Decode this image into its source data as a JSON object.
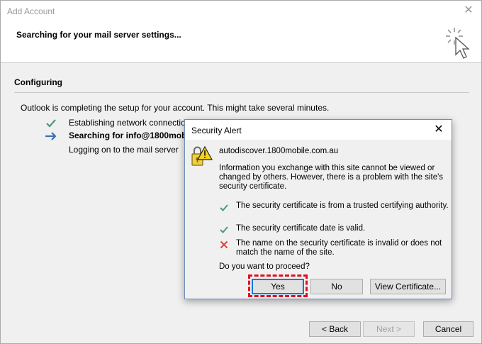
{
  "window": {
    "title": "Add Account",
    "close_glyph": "✕"
  },
  "header": {
    "heading": "Searching for your mail server settings...",
    "busy_icon": "busy-cursor-icon"
  },
  "section": {
    "title": "Configuring",
    "intro": "Outlook is completing the setup for your account. This might take several minutes."
  },
  "steps": [
    {
      "icon": "check-icon",
      "label": "Establishing network connection"
    },
    {
      "icon": "arrow-right-icon",
      "label": "Searching for info@1800mobile.com.au server settings"
    },
    {
      "icon": "none",
      "label": "Logging on to the mail server"
    }
  ],
  "footer": {
    "back_label": "< Back",
    "next_label": "Next >",
    "cancel_label": "Cancel"
  },
  "dialog": {
    "title": "Security Alert",
    "close_glyph": "✕",
    "host": "autodiscover.1800mobile.com.au",
    "message": "Information you exchange with this site cannot be viewed or changed by others. However, there is a problem with the site's security certificate.",
    "checks": [
      {
        "status": "ok",
        "icon": "check-icon",
        "text": "The security certificate is from a trusted certifying authority."
      },
      {
        "status": "ok",
        "icon": "check-icon",
        "text": "The security certificate date is valid."
      },
      {
        "status": "error",
        "icon": "error-x-icon",
        "text": "The name on the security certificate is invalid or does not match the name of the site."
      }
    ],
    "question": "Do you want to proceed?",
    "yes_label": "Yes",
    "no_label": "No",
    "view_cert_label": "View Certificate..."
  },
  "colors": {
    "ok": "#4a9a78",
    "error": "#d9463b",
    "arrow": "#3d6fb4",
    "highlight": "#e0101e"
  }
}
